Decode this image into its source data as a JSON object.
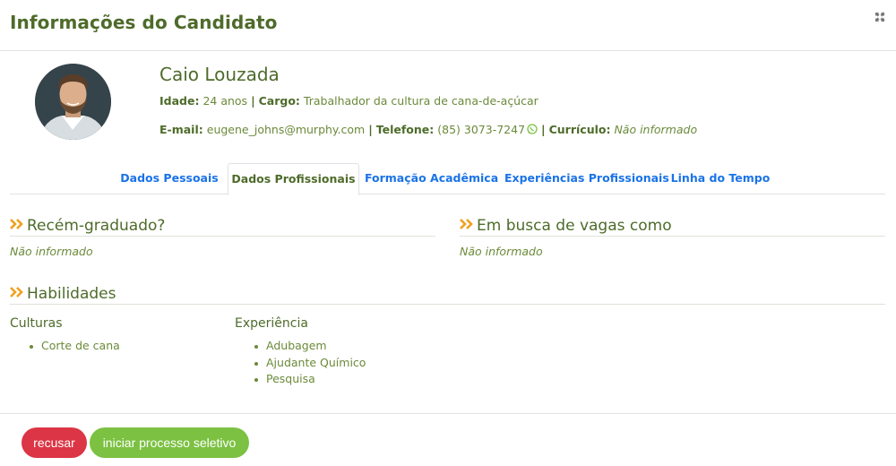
{
  "modal": {
    "title": "Informações do Candidato",
    "expand_icon": "expand-arrows-icon"
  },
  "candidate": {
    "name": "Caio Louzada",
    "age_label": "Idade:",
    "age_value": "24 anos",
    "separator": "|",
    "role_label": "Cargo:",
    "role_value": "Trabalhador da cultura de cana-de-açúcar",
    "email_label": "E-mail:",
    "email_value": "eugene_johns@murphy.com",
    "phone_label": "Telefone:",
    "phone_value": "(85) 3073-7247",
    "resume_label": "Currículo:",
    "resume_value": "Não informado"
  },
  "tabs": [
    {
      "label": "Dados Pessoais",
      "active": false
    },
    {
      "label": "Dados Profissionais",
      "active": true
    },
    {
      "label": "Formação Acadêmica",
      "active": false
    },
    {
      "label": "Experiências Profissionais",
      "active": false
    },
    {
      "label": "Linha do Tempo",
      "active": false
    }
  ],
  "sections": {
    "recent_grad": {
      "title": "Recém-graduado?",
      "value": "Não informado"
    },
    "seeking": {
      "title": "Em busca de vagas como",
      "value": "Não informado"
    },
    "skills": {
      "title": "Habilidades",
      "cultures_head": "Culturas",
      "cultures": [
        "Corte de cana"
      ],
      "experience_head": "Experiência",
      "experience": [
        "Adubagem",
        "Ajudante Químico",
        "Pesquisa"
      ]
    }
  },
  "footer": {
    "refuse_label": "recusar",
    "start_label": "iniciar processo seletivo"
  },
  "colors": {
    "title_green": "#4e6b2a",
    "text_green": "#6b8a3a",
    "link_blue": "#1a73e8",
    "chevron_orange": "#f0a01e",
    "whatsapp_green": "#7cc142",
    "refuse_red": "#dc3545",
    "start_green": "#7cc142"
  }
}
